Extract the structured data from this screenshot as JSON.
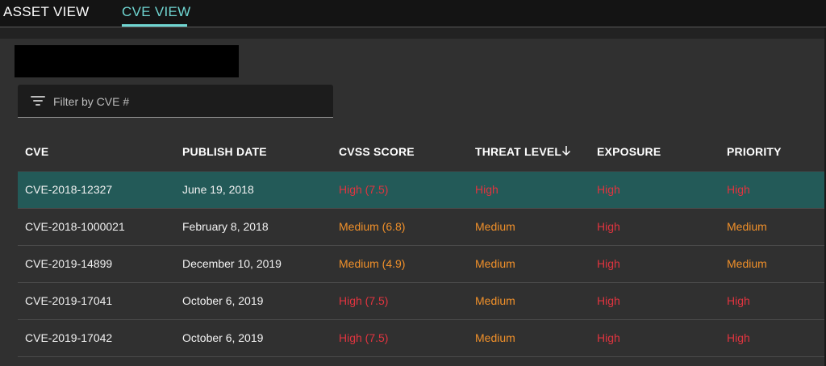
{
  "tabs": [
    {
      "label": "ASSET VIEW",
      "active": false
    },
    {
      "label": "CVE VIEW",
      "active": true
    }
  ],
  "filter": {
    "placeholder": "Filter by CVE #",
    "value": "",
    "icon": "filter-list-icon"
  },
  "table": {
    "columns": [
      "CVE",
      "PUBLISH DATE",
      "CVSS SCORE",
      "THREAT LEVEL",
      "EXPOSURE",
      "PRIORITY"
    ],
    "sort": {
      "column": "THREAT LEVEL",
      "direction": "descending",
      "icon": "arrow-down-icon"
    },
    "rows": [
      {
        "cve": "CVE-2018-12327",
        "date": "June 19, 2018",
        "cvss": "High (7.5)",
        "threat": "High",
        "exposure": "High",
        "priority": "High",
        "selected": true
      },
      {
        "cve": "CVE-2018-1000021",
        "date": "February 8, 2018",
        "cvss": "Medium (6.8)",
        "threat": "Medium",
        "exposure": "High",
        "priority": "Medium",
        "selected": false
      },
      {
        "cve": "CVE-2019-14899",
        "date": "December 10, 2019",
        "cvss": "Medium (4.9)",
        "threat": "Medium",
        "exposure": "High",
        "priority": "Medium",
        "selected": false
      },
      {
        "cve": "CVE-2019-17041",
        "date": "October 6, 2019",
        "cvss": "High (7.5)",
        "threat": "Medium",
        "exposure": "High",
        "priority": "High",
        "selected": false
      },
      {
        "cve": "CVE-2019-17042",
        "date": "October 6, 2019",
        "cvss": "High (7.5)",
        "threat": "Medium",
        "exposure": "High",
        "priority": "High",
        "selected": false
      }
    ]
  },
  "colors": {
    "accent": "#6fd5d1",
    "selected_row": "#235a58",
    "high": "#e0343f",
    "medium": "#f0902a"
  }
}
